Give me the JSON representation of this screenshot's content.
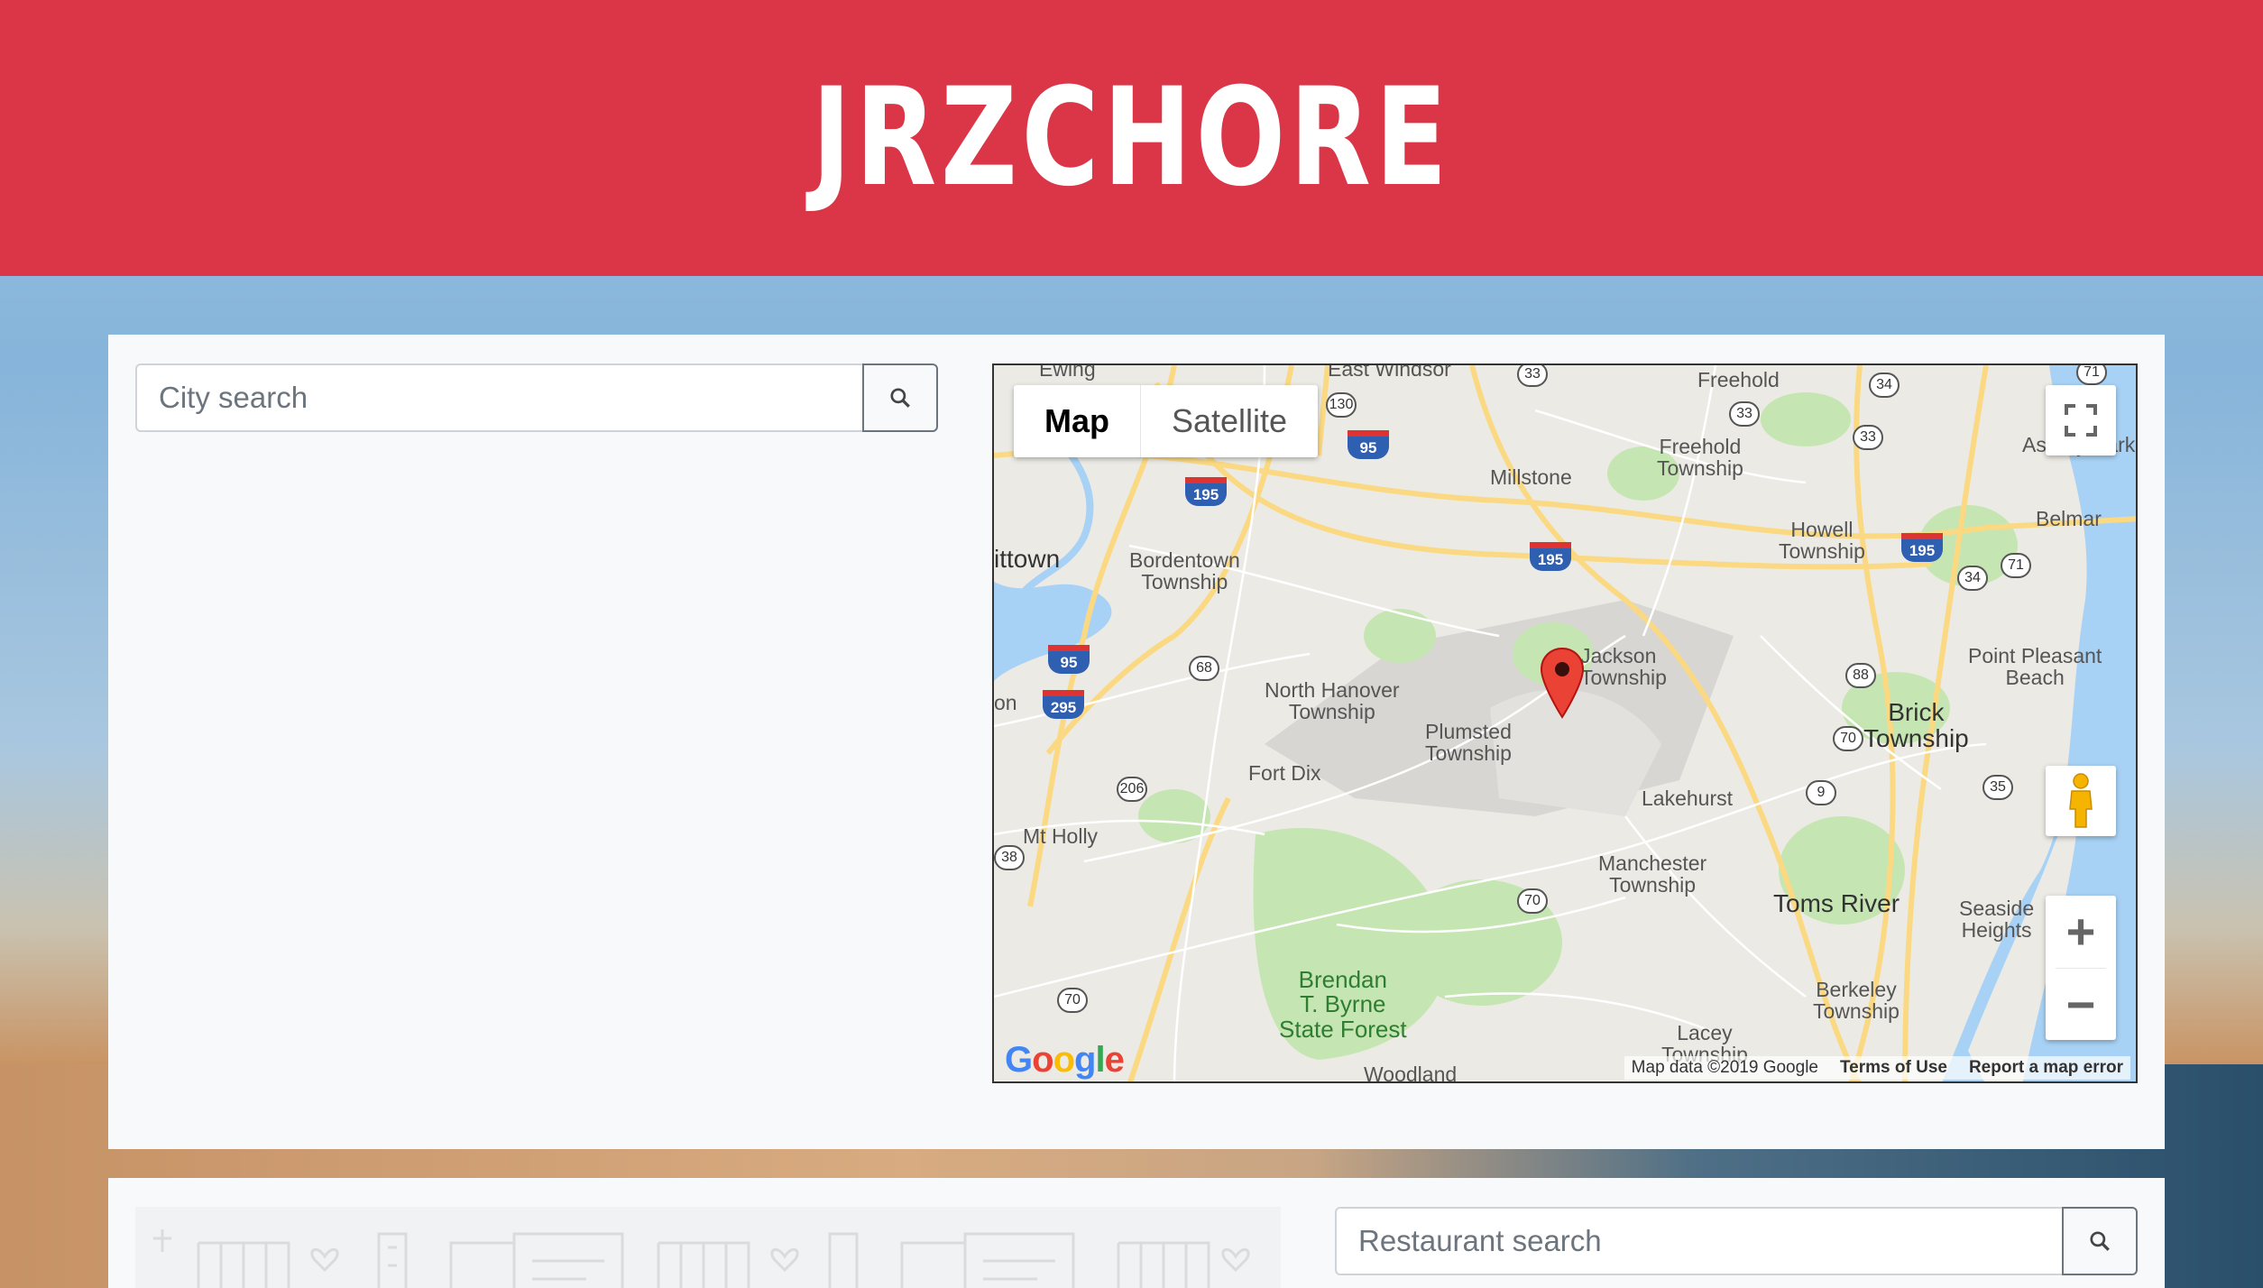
{
  "header": {
    "title": "JRZCHORE"
  },
  "city_search": {
    "placeholder": "City search"
  },
  "restaurant_search": {
    "placeholder": "Restaurant search"
  },
  "map": {
    "type_controls": {
      "map": "Map",
      "satellite": "Satellite"
    },
    "labels": {
      "ewing": "Ewing",
      "east_windsor": "East Windsor",
      "freehold": "Freehold",
      "freehold_township": "Freehold\nTownship",
      "millstone": "Millstone",
      "howell": "Howell\nTownship",
      "belmar": "Belmar",
      "asbury": "Asbury Park",
      "trenton": "ittown",
      "bordentown": "Bordentown\nTownship",
      "jackson": "Jackson\nTownship",
      "north_hanover": "North Hanover\nTownship",
      "plumsted": "Plumsted\nTownship",
      "point_pleasant": "Point Pleasant\nBeach",
      "brick": "Brick\nTownship",
      "fort_dix": "Fort Dix",
      "lakehurst": "Lakehurst",
      "mt_holly": "Mt Holly",
      "manchester": "Manchester\nTownship",
      "toms_river": "Toms River",
      "seaside": "Seaside\nHeights",
      "berkeley": "Berkeley\nTownship",
      "lacey": "Lacey\nTownship",
      "brendan": "Brendan\nT. Byrne\nState Forest",
      "woodland": "Woodland",
      "on": "on"
    },
    "routes": {
      "r33a": "33",
      "r130": "130",
      "r95a": "95",
      "r33b": "33",
      "r34a": "34",
      "r33c": "33",
      "r71a": "71",
      "i195a": "195",
      "i195b": "195",
      "i195c": "195",
      "r34b": "34",
      "r71b": "71",
      "i95b": "95",
      "i295": "295",
      "r68": "68",
      "r88": "88",
      "r70a": "70",
      "r9": "9",
      "r35": "35",
      "r206": "206",
      "r38": "38",
      "r70b": "70",
      "r70c": "70"
    },
    "attribution": {
      "data": "Map data ©2019 Google",
      "terms": "Terms of Use",
      "report": "Report a map error"
    },
    "logo": "Google"
  },
  "colors": {
    "header": "#da3647",
    "panel": "#f8f9fa",
    "water": "#a8d2f5",
    "park": "#c5e6b2",
    "road": "#fbd983"
  }
}
